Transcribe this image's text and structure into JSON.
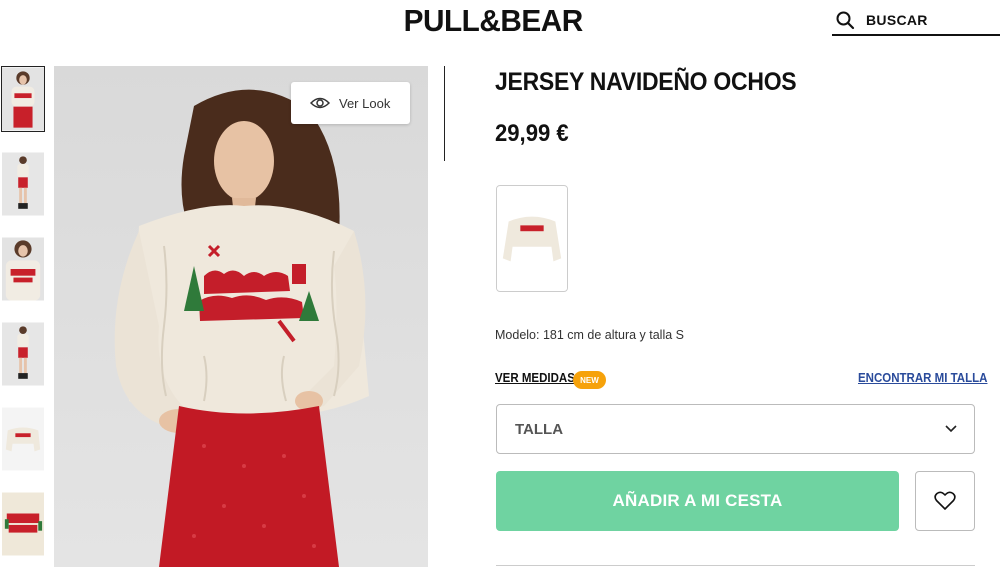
{
  "header": {
    "logo": "PULL&BEAR",
    "search_label": "BUSCAR"
  },
  "gallery": {
    "thumbnail_count": 6,
    "active_index": 0,
    "ver_look_label": "Ver Look"
  },
  "product": {
    "title": "JERSEY NAVIDEÑO OCHOS",
    "price": "29,99 €",
    "model_info": "Modelo: 181 cm de altura y talla S",
    "ver_medidas_label": "VER MEDIDAS",
    "new_badge": "NEW",
    "encontrar_talla_label": "ENCONTRAR MI TALLA",
    "size_select_placeholder": "TALLA",
    "add_to_cart_label": "AÑADIR A MI CESTA"
  },
  "colors": {
    "add_button": "#6fd3a1",
    "new_badge": "#f6a20b",
    "link_blue": "#2a4b9b"
  },
  "icons": {
    "search": "search-icon",
    "eye": "eye-icon",
    "chevron": "chevron-down-icon",
    "heart": "heart-icon"
  }
}
